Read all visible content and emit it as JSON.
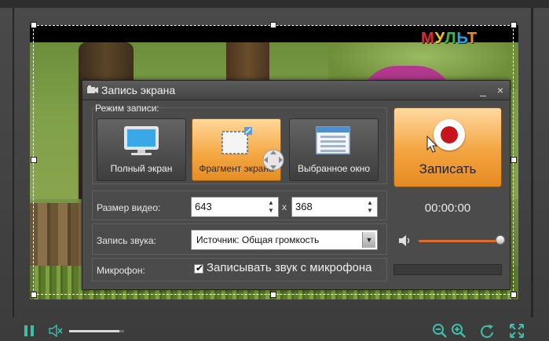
{
  "dialog": {
    "title": "Запись экрана",
    "minimize_glyph": "_",
    "close_glyph": "×",
    "mode_label": "Режим записи:",
    "modes": [
      {
        "label": "Полный экран",
        "icon": "monitor-icon",
        "active": false
      },
      {
        "label": "Фрагмент экрана",
        "icon": "fragment-icon",
        "active": true
      },
      {
        "label": "Выбранное окно",
        "icon": "window-icon",
        "active": false
      }
    ],
    "record_button_label": "Записать",
    "video_size_label": "Размер видео:",
    "width_value": "643",
    "height_value": "368",
    "times_sign": "x",
    "timer": "00:00:00",
    "audio_label": "Запись звука:",
    "audio_source": "Источник: Общая громкость",
    "mic_label": "Микрофон:",
    "mic_checkbox_label": "Записывать звук с микрофона",
    "mic_checked": true,
    "volume_level": 0.95
  },
  "video": {
    "logo_letters": [
      "М",
      "У",
      "Л",
      "Ь",
      "Т"
    ],
    "logo_colors": [
      "#e8232a",
      "#f6c21a",
      "#3bb54a",
      "#2a9ee0",
      "#f08a1c"
    ]
  },
  "player": {
    "volume_level": 0.9,
    "controls": [
      "pause-icon",
      "mute-icon",
      "zoom-out-icon",
      "zoom-in-icon",
      "rotate-icon",
      "fullscreen-icon"
    ]
  },
  "colors": {
    "accent_orange": "#f3a440",
    "record_red": "#c8151b",
    "volume_track": "#e36a2a",
    "control_teal": "#3fbfa8"
  }
}
